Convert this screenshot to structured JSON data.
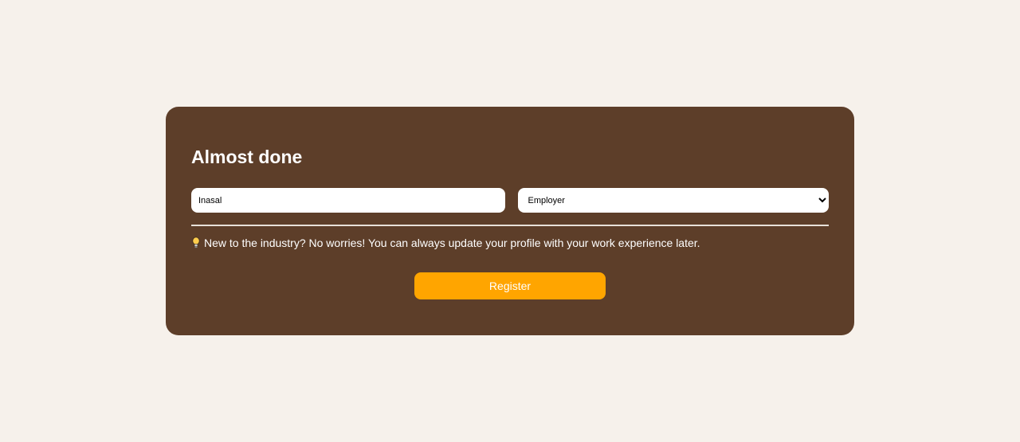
{
  "card": {
    "title": "Almost done"
  },
  "form": {
    "name_value": "Inasal",
    "role_selected": "Employer",
    "role_options": [
      "Employer"
    ]
  },
  "hint": {
    "icon": "lightbulb-icon",
    "text": "New to the industry? No worries! You can always update your profile with your work experience later."
  },
  "actions": {
    "register_label": "Register"
  },
  "colors": {
    "page_background": "#f6f1eb",
    "card_background": "#5d3e29",
    "accent": "#ffa500"
  }
}
